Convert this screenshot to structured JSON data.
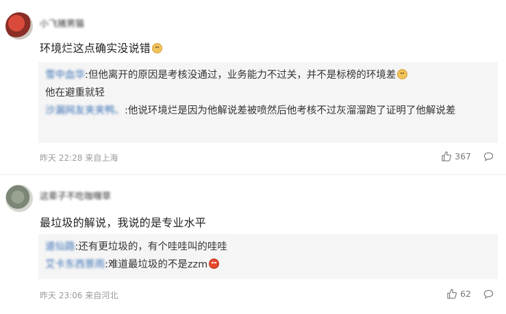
{
  "comments": [
    {
      "username": "小飞猪男猫",
      "text": "环境烂这点确实没说错",
      "text_emoji": "doge",
      "replies": [
        {
          "user": "雪中血华",
          "text": ":但他离开的原因是考核没通过，业务能力不过关，并不是标榜的环境差",
          "emoji": "doge",
          "continuation": "他在避重就轻"
        },
        {
          "user": "沙漏网友夹夹鸭、",
          "text": ":他说环境烂是因为他解说差被喷然后他考核不过灰溜溜跑了证明了他解说差"
        }
      ],
      "meta": "昨天 22:28 来自上海",
      "likes": "367"
    },
    {
      "username": "这辈子不吃咖喱草",
      "text": "最垃圾的解说，我说的是专业水平",
      "replies": [
        {
          "user": "道仙路",
          "text": ":还有更垃圾的，有个哇哇叫的哇哇"
        },
        {
          "user": "艾卡东西景雨",
          "text": ":难道最垃圾的不是zzm",
          "emoji": "angry"
        }
      ],
      "meta": "昨天 23:06 来自河北",
      "likes": "62"
    }
  ],
  "icons": {
    "like": "thumbs-up-icon",
    "reply": "comment-bubble-icon"
  },
  "colors": {
    "link": "#3f74b7",
    "reply_bg": "#f5f5f5",
    "meta": "#9a9a9a"
  }
}
